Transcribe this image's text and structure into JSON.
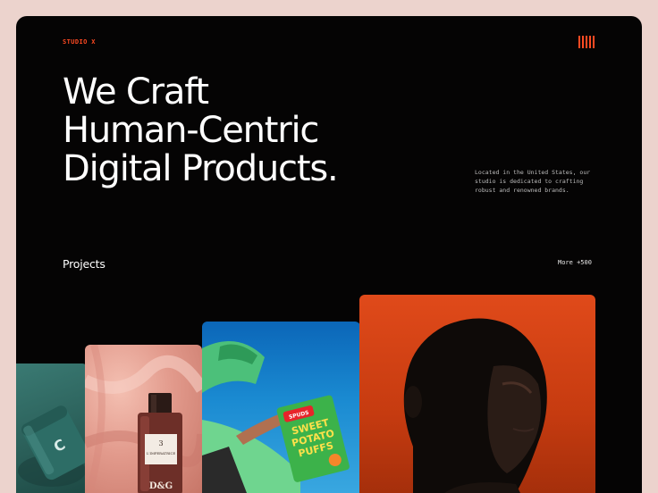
{
  "header": {
    "brand": "STUDIO X",
    "menu_icon": "hamburger-vertical-lines-icon",
    "accent_color": "#ff4a22"
  },
  "hero": {
    "headline_lines": [
      "We Craft",
      "Human-Centric",
      "Digital Products."
    ],
    "intro": "Located in the United States, our studio is dedicated to crafting robust and renowned brands."
  },
  "projects": {
    "label": "Projects",
    "more_label": "More +500",
    "cards": [
      {
        "name": "teal-can-project",
        "label": "C"
      },
      {
        "name": "perfume-project",
        "bottle_number": "3",
        "bottle_label": "L'IMPERATRICE",
        "bottle_brand": "D&G"
      },
      {
        "name": "snack-project",
        "bag_top": "SPUDS",
        "bag_line1": "SWEET",
        "bag_line2": "POTATO",
        "bag_line3": "PUFFS"
      },
      {
        "name": "portrait-project"
      }
    ]
  },
  "colors": {
    "background": "#ecd3cd",
    "panel": "#050404",
    "teal": "#2f6a64",
    "blush": "#e6a393",
    "blue": "#1a7cc8",
    "orange": "#d4431a"
  }
}
